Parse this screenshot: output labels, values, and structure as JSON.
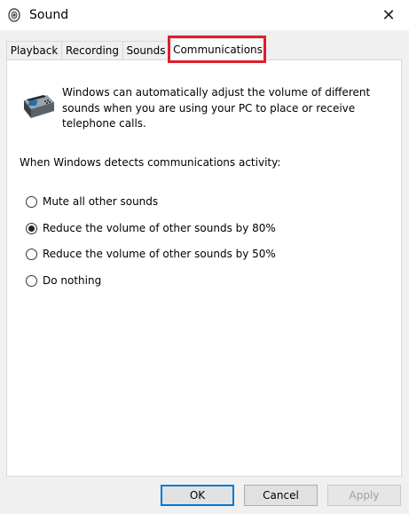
{
  "window": {
    "title": "Sound",
    "close_label": "✕"
  },
  "tabs": [
    {
      "label": "Playback",
      "active": false
    },
    {
      "label": "Recording",
      "active": false
    },
    {
      "label": "Sounds",
      "active": false
    },
    {
      "label": "Communications",
      "active": true
    }
  ],
  "highlight_color": "#e11d2b",
  "panel": {
    "description": "Windows can automatically adjust the volume of different sounds when you are using your PC to place or receive telephone calls.",
    "detect_label": "When Windows detects communications activity:",
    "options": [
      {
        "label": "Mute all other sounds",
        "checked": false
      },
      {
        "label": "Reduce the volume of other sounds by 80%",
        "checked": true
      },
      {
        "label": "Reduce the volume of other sounds by 50%",
        "checked": false
      },
      {
        "label": "Do nothing",
        "checked": false
      }
    ]
  },
  "buttons": {
    "ok": "OK",
    "cancel": "Cancel",
    "apply": "Apply"
  }
}
